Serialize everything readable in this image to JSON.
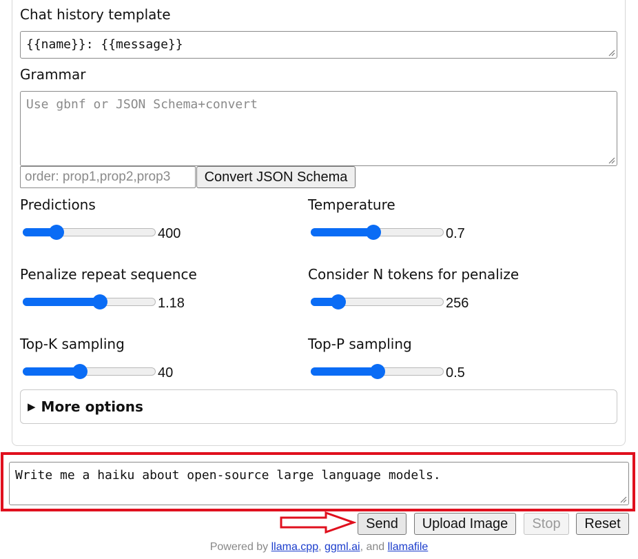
{
  "settings": {
    "chat_history_label": "Chat history template",
    "chat_history_value": "{{name}}: {{message}}",
    "grammar_label": "Grammar",
    "grammar_placeholder": "Use gbnf or JSON Schema+convert",
    "order_placeholder": "order: prop1,prop2,prop3",
    "convert_button": "Convert JSON Schema",
    "sliders": [
      {
        "label": "Predictions",
        "value": "400",
        "fraction": 0.22
      },
      {
        "label": "Temperature",
        "value": "0.7",
        "fraction": 0.47
      },
      {
        "label": "Penalize repeat sequence",
        "value": "1.18",
        "fraction": 0.59
      },
      {
        "label": "Consider N tokens for penalize",
        "value": "256",
        "fraction": 0.17
      },
      {
        "label": "Top-K sampling",
        "value": "40",
        "fraction": 0.42
      },
      {
        "label": "Top-P sampling",
        "value": "0.5",
        "fraction": 0.5
      }
    ],
    "more_options": "More options"
  },
  "message": {
    "value": "Write me a haiku about open-source large language models."
  },
  "buttons": {
    "send": "Send",
    "upload_image": "Upload Image",
    "stop": "Stop",
    "reset": "Reset"
  },
  "footer": {
    "prefix": "Powered by ",
    "link1": "llama.cpp",
    "sep1": ", ",
    "link2": "ggml.ai",
    "sep2": ", and ",
    "link3": "llamafile"
  },
  "colors": {
    "accent": "#0a6cf5",
    "annotation": "#e0101e"
  }
}
